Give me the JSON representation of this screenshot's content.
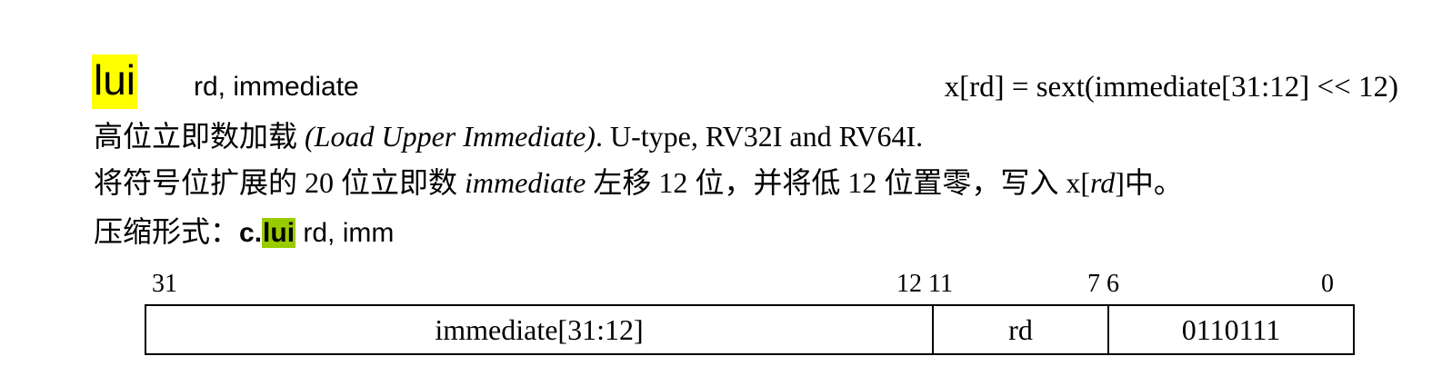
{
  "header": {
    "mnemonic": "lui",
    "operands": "rd, immediate",
    "semantics": "x[rd] = sext(immediate[31:12] << 12)"
  },
  "description": {
    "title_cn": "高位立即数加载",
    "title_en": "(Load Upper Immediate)",
    "type_info": ". U-type, RV32I and RV64I.",
    "detail_part1": "将符号位扩展的 20 位立即数 ",
    "detail_em1": "immediate",
    "detail_part2": " 左移 12 位，并将低 12 位置零，写入 x[",
    "detail_em2": "rd",
    "detail_part3": "]中。"
  },
  "compressed": {
    "label": "压缩形式：",
    "prefix": "c.",
    "mnemonic": "lui",
    "operands": " rd, imm"
  },
  "encoding": {
    "bit_labels": [
      "31",
      "12 11",
      "7 6",
      "0"
    ],
    "fields": [
      "immediate[31:12]",
      "rd",
      "0110111"
    ]
  },
  "colors": {
    "mnemonic_highlight": "#ffff00",
    "compressed_highlight": "#99cc00"
  }
}
